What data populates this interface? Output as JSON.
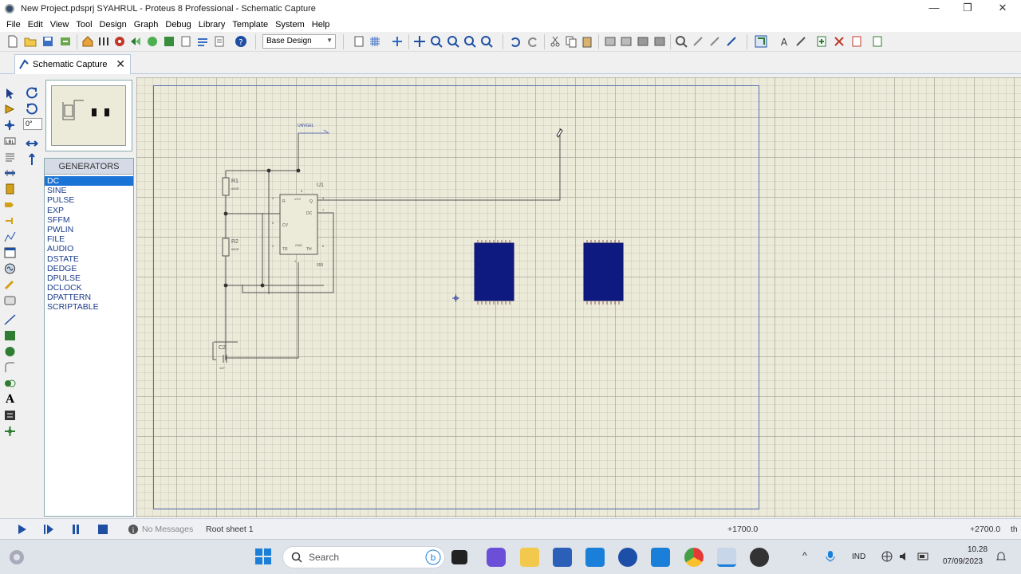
{
  "window": {
    "title": "New Project.pdsprj SYAHRUL - Proteus 8 Professional - Schematic Capture",
    "minimize": "—",
    "restore": "❐",
    "close": "✕"
  },
  "menu": [
    "File",
    "Edit",
    "View",
    "Tool",
    "Design",
    "Graph",
    "Debug",
    "Library",
    "Template",
    "System",
    "Help"
  ],
  "toolbar": {
    "design_select": "Base Design"
  },
  "tab": {
    "label": "Schematic Capture",
    "close": "✕"
  },
  "rotation": {
    "angle": "0°"
  },
  "devices": {
    "header": "GENERATORS",
    "items": [
      "DC",
      "SINE",
      "PULSE",
      "EXP",
      "SFFM",
      "PWLIN",
      "FILE",
      "AUDIO",
      "DSTATE",
      "DEDGE",
      "DPULSE",
      "DCLOCK",
      "DPATTERN",
      "SCRIPTABLE"
    ],
    "selected": "DC"
  },
  "schematic": {
    "r1_label": "R1",
    "r1_value": "680R",
    "r2_label": "R2",
    "r2_value": "680R",
    "u1_label": "U1",
    "c2_label": "C2",
    "c2_value": "1nF",
    "ic_pins": {
      "r": "R",
      "vcc": "VCC",
      "q": "Q",
      "dc": "DC",
      "cv": "CV",
      "gnd": "GND",
      "tr": "TR",
      "th": "TH"
    },
    "pin_numbers": [
      "4",
      "8",
      "3",
      "7",
      "5",
      "1",
      "2",
      "6"
    ],
    "ic_name": "555",
    "probe_label": "UNVGEL"
  },
  "status": {
    "messages": "No Messages",
    "sheet": "Root sheet 1",
    "coord_x": "+1700.0",
    "coord_y": "+2700.0",
    "units": "th"
  },
  "taskbar": {
    "search_placeholder": "Search",
    "lang": "IND",
    "time": "10.28",
    "date": "07/09/2023"
  }
}
